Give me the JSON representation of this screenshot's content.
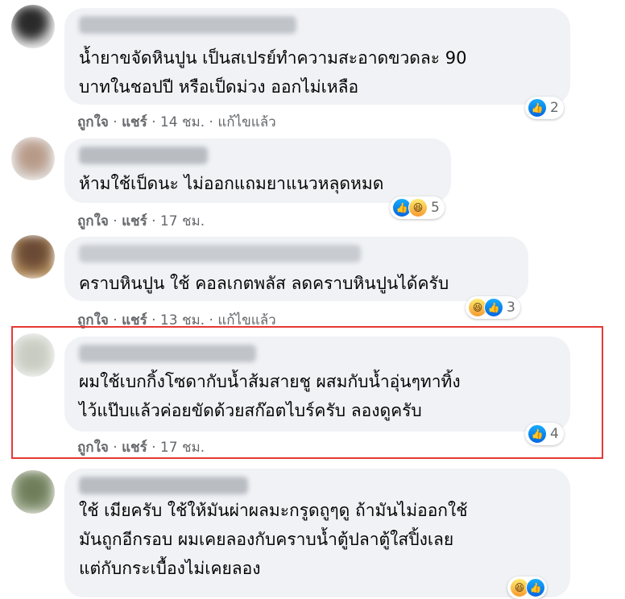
{
  "comments": [
    {
      "lines": [
        "น้ำยาขจัดหินปูน เป็นสเปรย์ทำความสะอาดขวดละ 90",
        "บาทในชอปปี หรือเป็ดม่วง ออกไม่เหลือ"
      ],
      "like": "ถูกใจ",
      "sep1": " · ",
      "share": "แชร์",
      "time": " · 14 ชม. · ",
      "edited": "แก้ไขแล้ว",
      "reaction_count": "2",
      "reaction_icons": [
        "like-icon"
      ]
    },
    {
      "lines": [
        "ห้ามใช้เป็ดนะ ไม่ออกแถมยาแนวหลุดหมด"
      ],
      "like": "ถูกใจ",
      "sep1": " · ",
      "share": "แชร์",
      "time": " · 17 ชม.",
      "edited": "",
      "reaction_count": "5",
      "reaction_icons": [
        "like-icon",
        "haha-icon"
      ]
    },
    {
      "lines": [
        "คราบหินปูน ใช้ คอลเกตพลัส ลดคราบหินปูนได้ครับ"
      ],
      "like": "ถูกใจ",
      "sep1": " · ",
      "share": "แชร์",
      "time": " · 13 ชม. · ",
      "edited": "แก้ไขแล้ว",
      "reaction_count": "3",
      "reaction_icons": [
        "haha-icon",
        "like-icon"
      ]
    },
    {
      "lines": [
        "ผมใช้เบกกิ้งโซดากับน้ำส้มสายชู ผสมกับน้ำอุ่นๆทาทิ้ง",
        "ไว้แป๊บแล้วค่อยขัดด้วยสก๊อตไบร์ครับ ลองดูครับ"
      ],
      "like": "ถูกใจ",
      "sep1": " · ",
      "share": "แชร์",
      "time": " · 17 ชม.",
      "edited": "",
      "reaction_count": "4",
      "reaction_icons": [
        "like-icon"
      ]
    },
    {
      "lines": [
        "ใช้ เมียครับ ใช้ให้มันผ่าผลมะกรูดถูๆดู ถ้ามันไม่ออกใช้",
        "มันถูกอีกรอบ ผมเคยลองกับคราบน้ำตู้ปลาตู้ใสปิ้งเลย",
        "แต่กับกระเบื้องไม่เคยลอง"
      ],
      "reaction_icons": [
        "haha-icon",
        "like-icon"
      ]
    }
  ],
  "colors": {
    "bubble": "#f0f2f5",
    "text": "#050505",
    "meta": "#65676b",
    "highlight": "#e53935",
    "like": "#0165e1"
  }
}
